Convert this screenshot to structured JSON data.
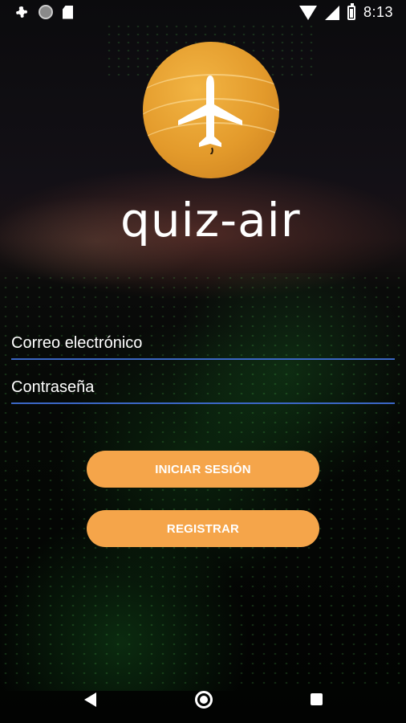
{
  "status_bar": {
    "time": "8:13",
    "left_icons": [
      "gear-icon",
      "circle-icon",
      "sd-card-icon"
    ],
    "right_icons": [
      "wifi-icon",
      "signal-icon",
      "battery-icon"
    ]
  },
  "logo": {
    "icon": "airplane-icon",
    "text": "quiz-air",
    "circle_color": "#E89E2E"
  },
  "form": {
    "email_placeholder": "Correo electrónico",
    "email_value": "",
    "password_placeholder": "Contraseña",
    "password_value": "",
    "underline_color": "#3B67C5"
  },
  "buttons": {
    "login_label": "INICIAR SESIÓN",
    "register_label": "REGISTRAR",
    "color": "#F5A54A"
  },
  "nav_bar": {
    "icons": [
      "back-icon",
      "home-icon",
      "recents-icon"
    ]
  }
}
